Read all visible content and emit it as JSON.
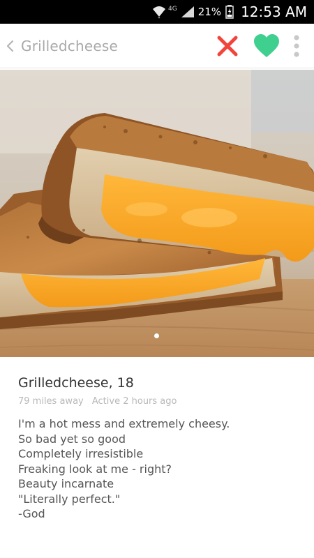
{
  "status_bar": {
    "network": "4G",
    "battery": "21%",
    "time": "12:53 AM"
  },
  "header": {
    "title": "Grilledcheese"
  },
  "profile": {
    "name_age": "Grilledcheese, 18",
    "distance": "79 miles away",
    "active": "Active 2 hours ago",
    "bio": [
      "I'm a hot mess and extremely cheesy.",
      "So bad yet so good",
      "Completely irresistible",
      "Freaking look at me - right?",
      "Beauty incarnate",
      "\"Literally perfect.\"",
      "-God"
    ]
  },
  "colors": {
    "dislike": "#f0443c",
    "like": "#3fcf8e",
    "muted": "#c8c8c8"
  },
  "icons": [
    "wifi-icon",
    "signal-icon",
    "battery-icon",
    "back-chevron-icon",
    "close-icon",
    "heart-icon",
    "more-vertical-icon"
  ]
}
